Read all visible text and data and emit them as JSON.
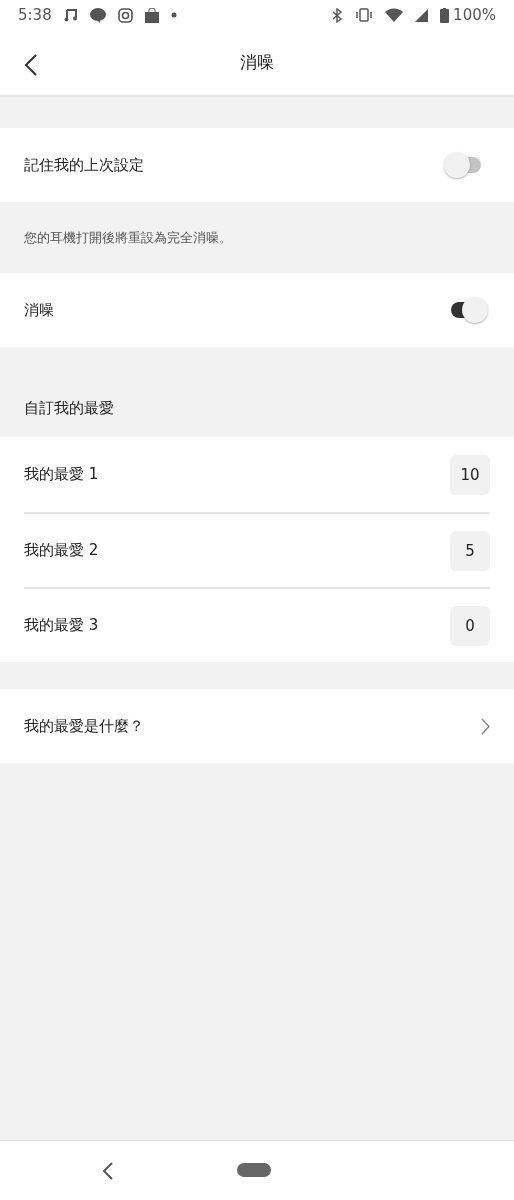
{
  "status_bar": {
    "time": "5:38",
    "battery": "100%"
  },
  "header": {
    "title": "消噪"
  },
  "settings": [
    {
      "kind": "toggle",
      "label": "記住我的上次設定",
      "on": false
    },
    {
      "kind": "note",
      "label": "您的耳機打開後將重設為完全消噪。"
    },
    {
      "kind": "toggle",
      "label": "消噪",
      "on": true
    }
  ],
  "favorites": {
    "title": "自訂我的最愛",
    "items": [
      {
        "label": "我的最愛 1",
        "value": "10"
      },
      {
        "label": "我的最愛 2",
        "value": "5"
      },
      {
        "label": "我的最愛 3",
        "value": "0"
      }
    ]
  },
  "help": {
    "label": "我的最愛是什麼？"
  }
}
